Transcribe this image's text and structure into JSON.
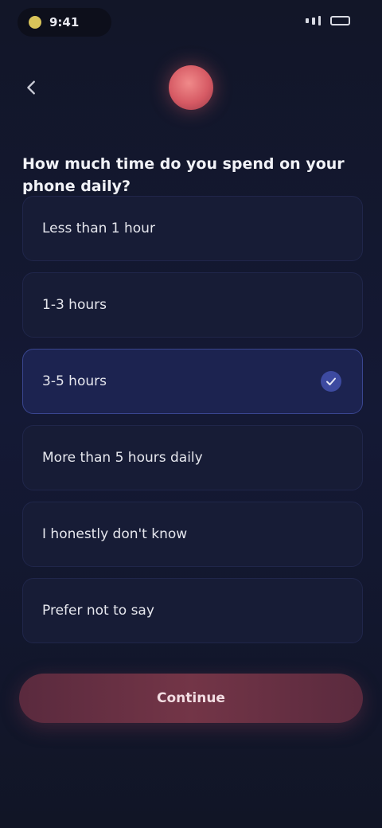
{
  "status_bar": {
    "time": "9:41"
  },
  "header": {
    "back_icon": "chevron-left-icon",
    "logo_icon": "brand-logo-icon"
  },
  "question": {
    "text": "How much time do you spend on your phone daily?"
  },
  "options": [
    {
      "label": "Less than 1 hour",
      "selected": false
    },
    {
      "label": "1-3 hours",
      "selected": false
    },
    {
      "label": "3-5 hours",
      "selected": true
    },
    {
      "label": "More than 5 hours daily",
      "selected": false
    },
    {
      "label": "I honestly don't know",
      "selected": false
    },
    {
      "label": "Prefer not to say",
      "selected": false
    }
  ],
  "footer": {
    "continue_label": "Continue"
  },
  "colors": {
    "background": "#121628",
    "option_bg": "#171c36",
    "selected_bg": "#1c2350",
    "accent": "#d65a64",
    "button_bg": "#733547"
  }
}
